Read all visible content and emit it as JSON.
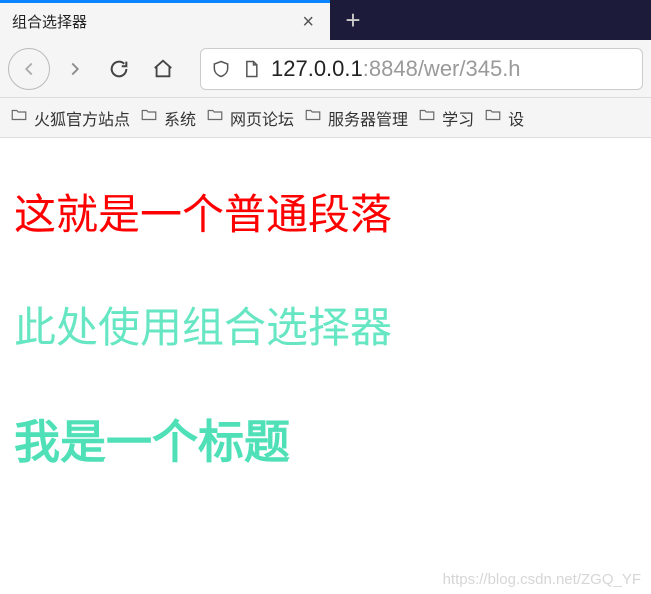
{
  "tab": {
    "title": "组合选择器"
  },
  "url": {
    "host": "127.0.0.1",
    "port": ":8848",
    "path": "/wer/345.h"
  },
  "bookmarks": [
    {
      "label": "火狐官方站点"
    },
    {
      "label": "系统"
    },
    {
      "label": "网页论坛"
    },
    {
      "label": "服务器管理"
    },
    {
      "label": "学习"
    },
    {
      "label": "设"
    }
  ],
  "content": {
    "paragraph1": "这就是一个普通段落",
    "paragraph2": "此处使用组合选择器",
    "heading": "我是一个标题"
  },
  "watermark": "https://blog.csdn.net/ZGQ_YF"
}
